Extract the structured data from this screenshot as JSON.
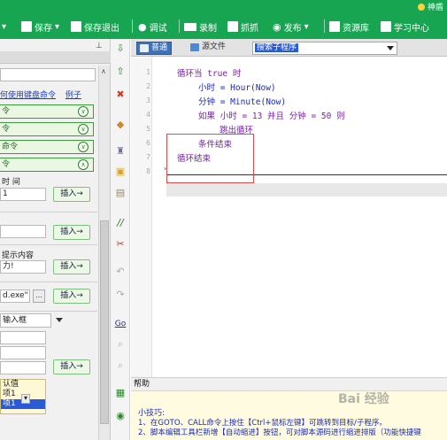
{
  "toolbar": {
    "items": [
      {
        "label": "保存",
        "icon": "save-icon"
      },
      {
        "label": "保存退出",
        "icon": "save-exit-icon"
      },
      {
        "label": "调试",
        "icon": "debug-play-icon"
      },
      {
        "label": "录制",
        "icon": "record-icon"
      },
      {
        "label": "抓抓",
        "icon": "capture-icon"
      },
      {
        "label": "发布",
        "icon": "publish-icon"
      },
      {
        "label": "资源库",
        "icon": "resource-icon"
      },
      {
        "label": "学习中心",
        "icon": "learning-icon"
      }
    ],
    "corner_label": "神盾",
    "colors": {
      "toolbar_bg": "#18a552"
    }
  },
  "left_panel": {
    "search_value": "",
    "help_link": "何使用键盘命令",
    "example_link": "例子",
    "command_rows": [
      {
        "label": "令",
        "expanded": false
      },
      {
        "label": "令",
        "expanded": false
      },
      {
        "label": "命令",
        "expanded": false
      },
      {
        "label": "令",
        "expanded": true
      }
    ],
    "time_label": "时 间",
    "time_value": "1",
    "insert_label": "插入→",
    "prompt_label": "提示内容",
    "prompt_value": "力!",
    "path_value": "d.exe\"",
    "browse_label": "...",
    "input_box_label": "输入框",
    "default_value_label": "认值",
    "list_items": [
      "认值",
      "项1",
      "项1"
    ]
  },
  "tabs": [
    {
      "label": "普通",
      "active": true
    },
    {
      "label": "源文件",
      "active": false
    }
  ],
  "sub_select": "搜索子程序",
  "editor": {
    "line_numbers": [
      "1",
      "2",
      "3",
      "4",
      "5",
      "6",
      "7",
      "8"
    ],
    "lines": [
      "循环当 true 时",
      "小时 = Hour(Now)",
      "分钟 = Minute(Now)",
      "如果 小时 = 13 并且 分钟 = 50 则",
      "跳出循环",
      "条件结束",
      "循环结束"
    ]
  },
  "help": {
    "header": "帮助",
    "tips_title": "小技巧:",
    "tip1": "1、在GOTO、CALL命令上按住【Ctrl+鼠标左键】可跳转到目标/子程序。",
    "tip2": "2、脚本编辑工具栏新增【自动缩进】按钮，可对脚本源码进行缩进排版（功能快捷键"
  },
  "watermark": "Bai 经验"
}
